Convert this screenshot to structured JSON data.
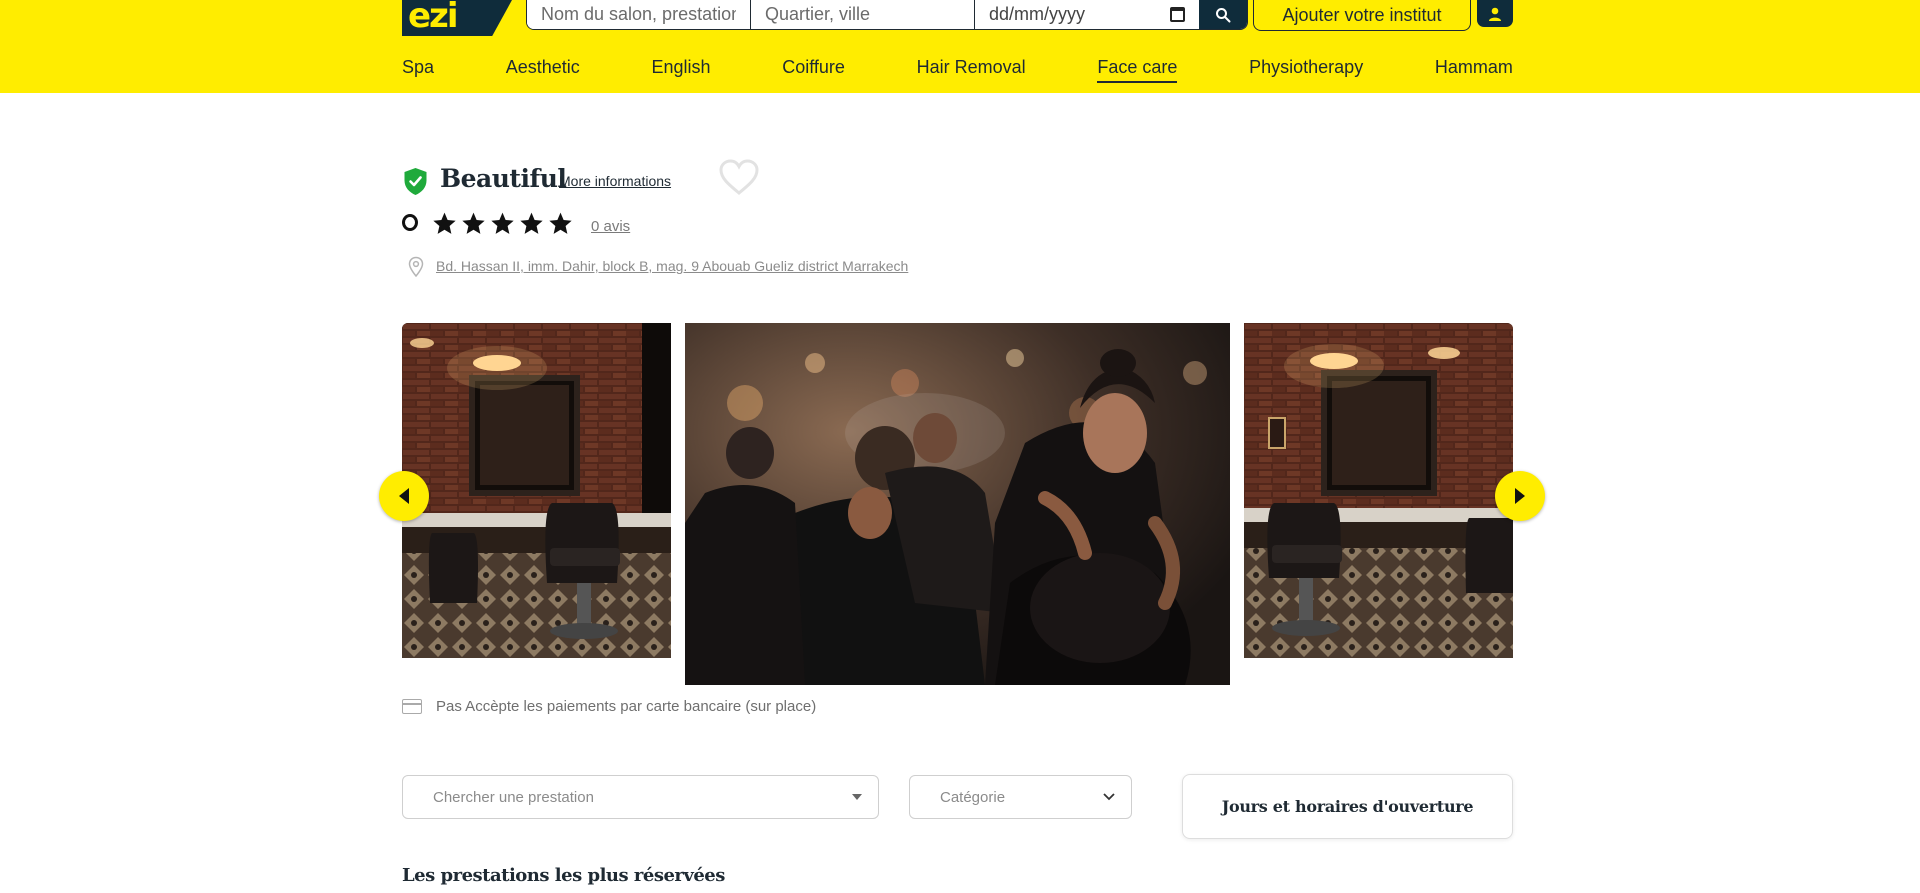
{
  "header": {
    "logo_text": "ezi",
    "search": {
      "name_placeholder": "Nom du salon, prestation",
      "place_placeholder": "Quartier, ville",
      "date_placeholder": "dd/mm/yyyy"
    },
    "add_institute_label": "Ajouter votre institut",
    "brand_color": "#ffed00",
    "dark_color": "#0f2c3b"
  },
  "nav": {
    "items": [
      {
        "label": "Spa",
        "active": false
      },
      {
        "label": "Aesthetic",
        "active": false
      },
      {
        "label": "English",
        "active": false
      },
      {
        "label": "Coiffure",
        "active": false
      },
      {
        "label": "Hair Removal",
        "active": false
      },
      {
        "label": "Face care",
        "active": true
      },
      {
        "label": "Physiotherapy",
        "active": false
      },
      {
        "label": "Hammam",
        "active": false
      }
    ]
  },
  "salon": {
    "name": "Beautiful",
    "more_info_label": "More informations",
    "rating": "0",
    "stars": 5,
    "reviews_label": "0 avis",
    "address": "Bd. Hassan II, imm. Dahir, block B, mag. 9 Abouab Gueliz district Marrakech",
    "verified_color": "#1faa3b"
  },
  "payment_note": "Pas Accèpte les paiements par carte bancaire (sur place)",
  "filters": {
    "service_placeholder": "Chercher une prestation",
    "category_placeholder": "Catégorie",
    "hours_label": "Jours et horaires d'ouverture"
  },
  "section_title": "Les prestations les plus réservées"
}
